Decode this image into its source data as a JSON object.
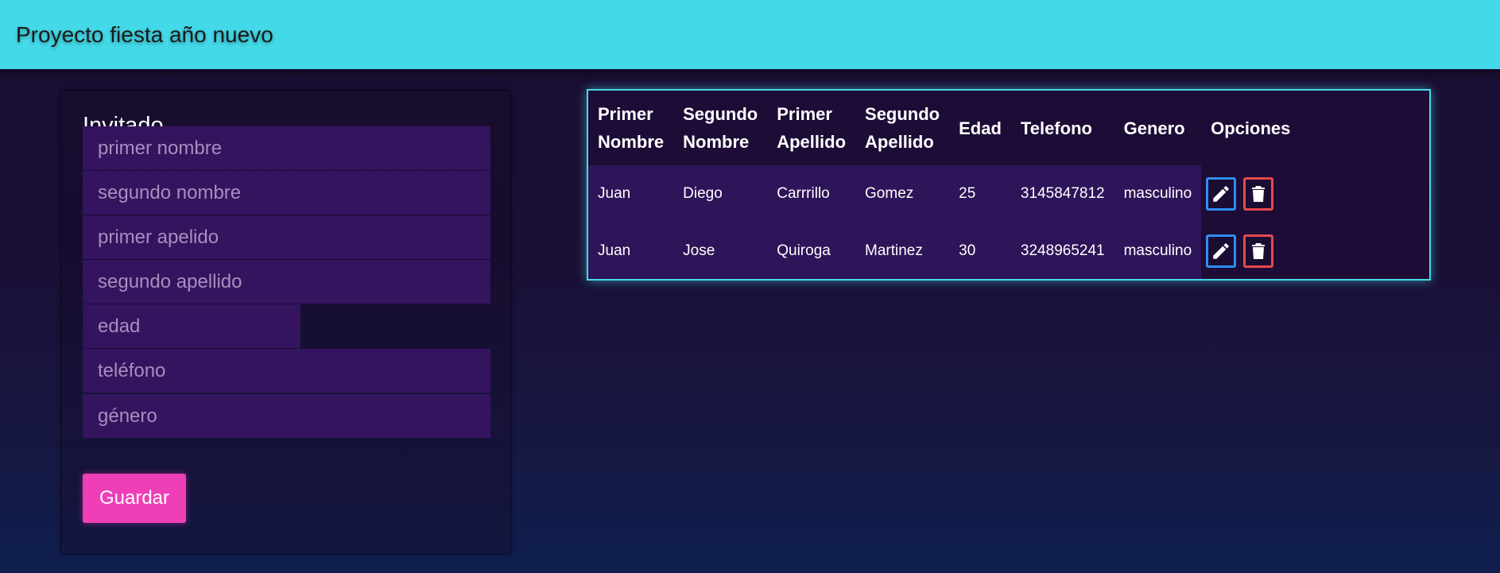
{
  "navbar": {
    "title": "Proyecto fiesta año nuevo"
  },
  "form": {
    "title": "Invitado",
    "fields": {
      "primer_nombre": "primer nombre",
      "segundo_nombre": "segundo nombre",
      "primer_apellido": "primer apelido",
      "segundo_apellido": "segundo apellido",
      "edad": "edad",
      "telefono": "teléfono",
      "genero": "género"
    },
    "save_label": "Guardar"
  },
  "table": {
    "headers": {
      "primer_nombre": [
        "Primer",
        "Nombre"
      ],
      "segundo_nombre": [
        "Segundo",
        "Nombre"
      ],
      "primer_apellido": [
        "Primer",
        "Apellido"
      ],
      "segundo_apellido": [
        "Segundo",
        "Apellido"
      ],
      "edad": "Edad",
      "telefono": "Telefono",
      "genero": "Genero",
      "opciones": "Opciones"
    },
    "rows": [
      {
        "primer_nombre": "Juan",
        "segundo_nombre": "Diego",
        "primer_apellido": "Carrrillo",
        "segundo_apellido": "Gomez",
        "edad": "25",
        "telefono": "3145847812",
        "genero": "masculino"
      },
      {
        "primer_nombre": "Juan",
        "segundo_nombre": "Jose",
        "primer_apellido": "Quiroga",
        "segundo_apellido": "Martinez",
        "edad": "30",
        "telefono": "3248965241",
        "genero": "masculino"
      }
    ]
  },
  "icons": {
    "edit": "pencil-icon",
    "delete": "trash-icon"
  },
  "colors": {
    "navbar": "#44d9e8",
    "input_bg": "#34145f",
    "save_button": "#ee3fb6",
    "edit_border": "#2f8df5",
    "delete_border": "#e8474f",
    "table_border": "#44d9e8"
  }
}
